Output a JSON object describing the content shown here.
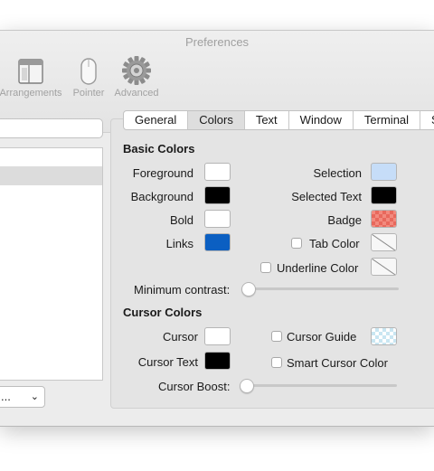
{
  "window": {
    "title": "Preferences"
  },
  "toolbar": {
    "items": [
      {
        "label": "Arrangements",
        "icon": "arrangements-icon"
      },
      {
        "label": "Pointer",
        "icon": "mouse-icon"
      },
      {
        "label": "Advanced",
        "icon": "gear-icon"
      }
    ]
  },
  "sidebar": {
    "other_actions_label": "..."
  },
  "tabs": [
    "General",
    "Colors",
    "Text",
    "Window",
    "Terminal",
    "S"
  ],
  "active_tab": "Colors",
  "basic_colors": {
    "heading": "Basic Colors",
    "foreground": {
      "label": "Foreground",
      "color": "#ffffff"
    },
    "background": {
      "label": "Background",
      "color": "#000000"
    },
    "bold": {
      "label": "Bold",
      "color": "#ffffff"
    },
    "links": {
      "label": "Links",
      "color": "#0b5fc2"
    },
    "selection": {
      "label": "Selection",
      "color": "#c6ddf8"
    },
    "selected_text": {
      "label": "Selected Text",
      "color": "#000000"
    },
    "badge": {
      "label": "Badge",
      "color": "#f0776b"
    },
    "tab_color": {
      "label": "Tab Color",
      "checked": false
    },
    "underline_color": {
      "label": "Underline Color",
      "checked": false
    },
    "minimum_contrast": {
      "label": "Minimum contrast:",
      "value": 0
    }
  },
  "cursor_colors": {
    "heading": "Cursor Colors",
    "cursor": {
      "label": "Cursor",
      "color": "#ffffff"
    },
    "cursor_text": {
      "label": "Cursor Text",
      "color": "#000000"
    },
    "cursor_guide": {
      "label": "Cursor Guide",
      "checked": false,
      "color": "#c9e6f2"
    },
    "smart_cursor_color": {
      "label": "Smart Cursor Color",
      "checked": false
    },
    "cursor_boost": {
      "label": "Cursor Boost:",
      "value": 0
    }
  }
}
